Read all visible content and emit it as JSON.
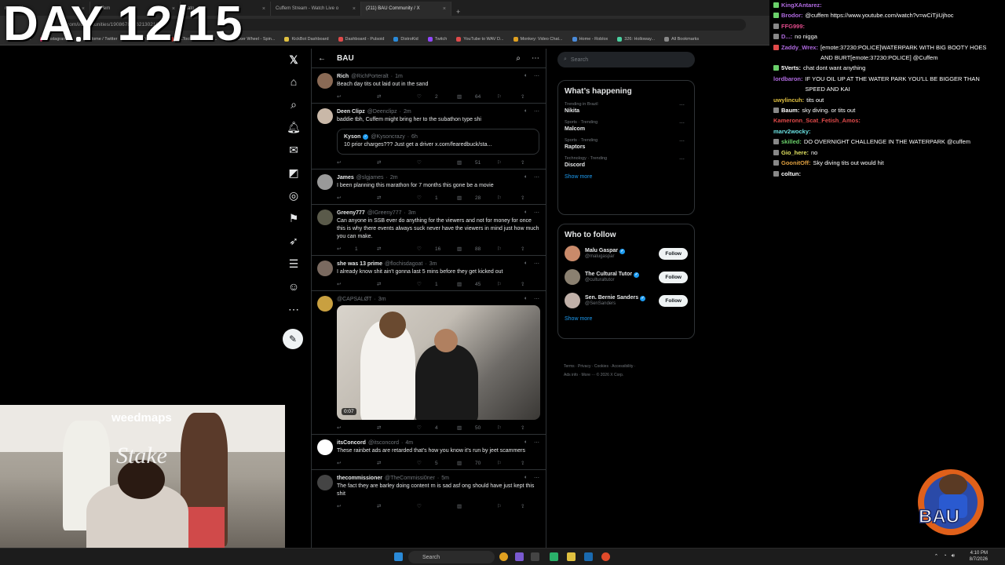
{
  "overlay": {
    "day_text": "DAY 12/15"
  },
  "browser": {
    "tabs": [
      {
        "label": "ream - X",
        "active": false
      },
      {
        "label": "Cuffem",
        "active": false
      },
      {
        "label": "cato",
        "active": false
      },
      {
        "label": "Cuffem Stream - Watch Live o",
        "active": false
      },
      {
        "label": "(211) BAU Community / X",
        "active": true
      }
    ],
    "url": "x.com/i/communities/190867851621302169",
    "bookmarks": [
      "Kick",
      "Instagram",
      "(1) Home / Twitter",
      "(31) YouTube",
      "IRLToolkit • Dashbo...",
      "Picker Wheel - Spin...",
      "KickBot Dashboard",
      "Dashboard - Pulsoid",
      "DistroKid",
      "Twitch",
      "YouTube to WAV D...",
      "Monkey: Video Chat...",
      "Home - Roblox",
      "326: Holloway...",
      "All Bookmarks"
    ],
    "ask_gemini": "Ask Gemini"
  },
  "timeline": {
    "title": "BAU",
    "posts": [
      {
        "name": "Rich",
        "handle": "@RichPorteralt",
        "time": "1m",
        "text": "Beach day tits out laid out in the sand",
        "replies": "",
        "retweets": "",
        "likes": "2",
        "views": "64",
        "avatar_color": "#8a6a55"
      },
      {
        "name": "Deen Clipz",
        "handle": "@Deenclipz",
        "time": "2m",
        "text": "baddie tbh, Cuffem might bring her to the subathon type shi",
        "replies": "",
        "retweets": "",
        "likes": "",
        "views": "51",
        "avatar_color": "#c9b8a8",
        "quote": {
          "name": "Kyson",
          "handle": "@Kysoncrazy",
          "time": "6h",
          "text": "10 prior charges??? Just get a driver x.com/fearedbuck/sta..."
        }
      },
      {
        "name": "James",
        "handle": "@slgjames",
        "time": "2m",
        "text": "I been planning this marathon for 7 months this gone be a movie",
        "replies": "",
        "retweets": "",
        "likes": "1",
        "views": "28",
        "avatar_color": "#999"
      },
      {
        "name": "Greeny777",
        "handle": "@IGreeny777",
        "time": "3m",
        "text": "Can anyone in SSB ever do anything for the viewers and not for money for once this is why there events always suck never have the viewers in mind just how much you can make.",
        "replies": "1",
        "retweets": "",
        "likes": "16",
        "views": "88",
        "avatar_color": "#5a5a4a"
      },
      {
        "name": "she was 13 prime",
        "handle": "@flochisdagoat",
        "time": "3m",
        "text": "I already know shit ain't gonna last 5 mins before they get kicked out",
        "replies": "",
        "retweets": "",
        "likes": "1",
        "views": "45",
        "avatar_color": "#7a6a60"
      },
      {
        "name": "",
        "handle": "@CAPSALØT",
        "time": "3m",
        "text": "",
        "replies": "",
        "retweets": "",
        "likes": "4",
        "views": "50",
        "avatar_color": "#c9a040",
        "video": {
          "duration": "0:07"
        }
      },
      {
        "name": "itsConcord",
        "handle": "@itsconcord",
        "time": "4m",
        "text": "These rainbet ads are retarded that's how you know it's run by jeet scammers",
        "replies": "",
        "retweets": "",
        "likes": "5",
        "views": "70",
        "avatar_color": "#ffffff"
      },
      {
        "name": "thecommissioner",
        "handle": "@TheCommissi0ner",
        "time": "5m",
        "text": "The fact they are barley doing content rn is sad asf ong should have just kept this shit",
        "replies": "",
        "retweets": "",
        "likes": "",
        "views": "",
        "avatar_color": "#444"
      }
    ]
  },
  "right": {
    "search_placeholder": "Search",
    "trends_title": "What’s happening",
    "trends": [
      {
        "context": "Trending in Brazil",
        "name": "Nikita"
      },
      {
        "context": "Sports · Trending",
        "name": "Malcom"
      },
      {
        "context": "Sports · Trending",
        "name": "Raptors"
      },
      {
        "context": "Technology · Trending",
        "name": "Discord"
      }
    ],
    "show_more": "Show more",
    "wtf_title": "Who to follow",
    "follow_label": "Follow",
    "wtf": [
      {
        "name": "Malu Gaspar",
        "handle": "@malugaspar",
        "color": "#c98a6a"
      },
      {
        "name": "The Cultural Tutor",
        "handle": "@culturaltutor",
        "color": "#8a8070"
      },
      {
        "name": "Sen. Bernie Sanders",
        "handle": "@SenSanders",
        "color": "#c0b0a8"
      }
    ],
    "footer_line1": "Terms · Privacy · Cookies · Accessibility ·",
    "footer_line2": "Ads info · More ··· © 2026 X Corp."
  },
  "chat": [
    {
      "user": "KingXAntarez:",
      "msg": "",
      "color": "#b06ae0",
      "badge": "#6ad06a"
    },
    {
      "user": "Brodor:",
      "msg": "@cuffem https://www.youtube.com/watch?v=wCiTjiUjhoc",
      "color": "#b06ae0",
      "badge": "#6ad06a"
    },
    {
      "user": "FFG999:",
      "msg": "",
      "color": "#e04a8a",
      "badge": "#888"
    },
    {
      "user": "D...:",
      "msg": "no nigga",
      "color": "#b06ae0",
      "badge": "#888"
    },
    {
      "user": "Zaddy_Wrex:",
      "msg": "[emote:37230:POLICE]WATERPARK WITH BIG BOOTY HOES AND BURT[emote:37230:POLICE] @Cuffem",
      "color": "#b06ae0",
      "badge": "#e04a4a"
    },
    {
      "user": "5Verts:",
      "msg": "chat dont want anything",
      "color": "#ffffff",
      "badge": "#6ad06a"
    },
    {
      "user": "lordbaron:",
      "msg": "IF YOU OIL UP AT THE WATER PARK YOU'LL BE BIGGER THAN SPEED AND KAI",
      "color": "#b06ae0",
      "badge": ""
    },
    {
      "user": "uwylincuh:",
      "msg": "tits out",
      "color": "#e0c040",
      "badge": ""
    },
    {
      "user": "Baum:",
      "msg": "sky diving. or tits out",
      "color": "#ffffff",
      "badge": "#888"
    },
    {
      "user": "Kameronn_Scat_Fetish_Amos:",
      "msg": "",
      "color": "#e04a4a",
      "badge": ""
    },
    {
      "user": "marv2wocky:",
      "msg": "",
      "color": "#6ae0e0",
      "badge": ""
    },
    {
      "user": "skilled:",
      "msg": "DO OVERNIGHT CHALLENGE IN THE WATERPARK @cuffem",
      "color": "#6ad06a",
      "badge": "#888"
    },
    {
      "user": "Gio_here:",
      "msg": "no",
      "color": "#e0e060",
      "badge": "#888"
    },
    {
      "user": "GoonitOff:",
      "msg": "Sky diving tits out would hit",
      "color": "#e0a040",
      "badge": "#888"
    },
    {
      "user": "coltun:",
      "msg": "",
      "color": "#ffffff",
      "badge": "#888"
    }
  ],
  "webcam": {
    "sponsor1": "weedmaps",
    "sponsor2": "Stake"
  },
  "logo": {
    "text": "BAU"
  },
  "taskbar": {
    "search_placeholder": "Search",
    "time": "4:10 PM",
    "date": "8/7/2026"
  }
}
